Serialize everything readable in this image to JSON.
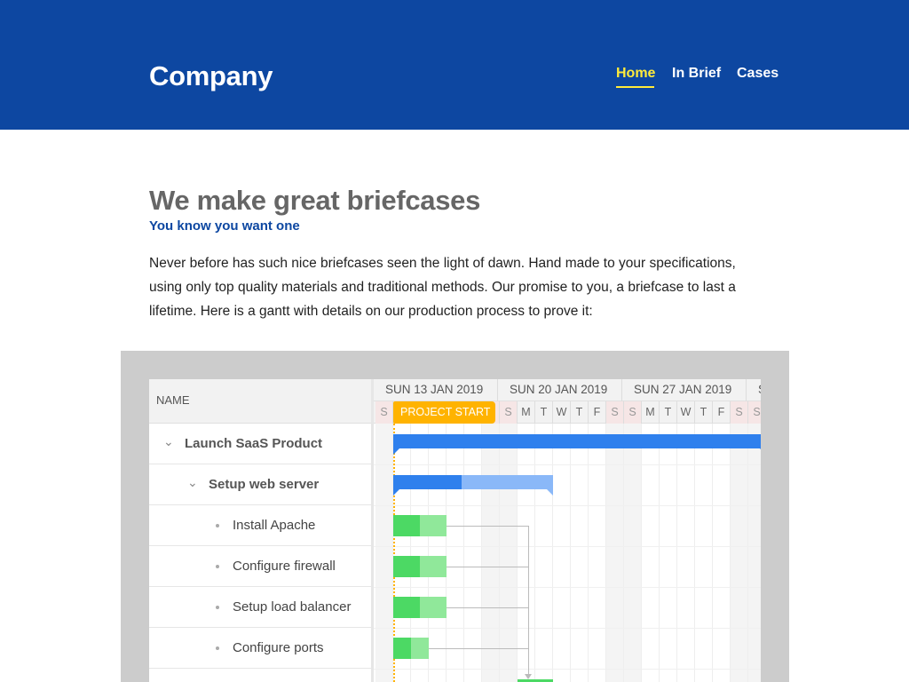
{
  "header": {
    "brand": "Company",
    "nav": [
      {
        "label": "Home",
        "active": true
      },
      {
        "label": "In Brief",
        "active": false
      },
      {
        "label": "Cases",
        "active": false
      }
    ]
  },
  "content": {
    "headline": "We make great briefcases",
    "subheadline": "You know you want one",
    "intro": "Never before has such nice briefcases seen the light of dawn. Hand made to your specifications, using only top quality materials and traditional methods. Our promise to you, a briefcase to last a lifetime. Here is a gantt with details on our production process to prove it:"
  },
  "gantt": {
    "name_header": "NAME",
    "weeks": [
      "SUN 13 JAN 2019",
      "SUN 20 JAN 2019",
      "SUN 27 JAN 2019",
      "S"
    ],
    "days": [
      "S",
      "M",
      "T",
      "W",
      "T",
      "F",
      "S",
      "S",
      "M",
      "T",
      "W",
      "T",
      "F",
      "S",
      "S",
      "M",
      "T",
      "W",
      "T",
      "F",
      "S",
      "S"
    ],
    "project_start_label": "PROJECT START",
    "tasks": [
      {
        "name": "Launch SaaS Product",
        "level": 0,
        "parent": true,
        "percent_done": 100
      },
      {
        "name": "Setup web server",
        "level": 1,
        "parent": true,
        "percent_done": 43
      },
      {
        "name": "Install Apache",
        "level": 2,
        "parent": false,
        "percent_done": 50
      },
      {
        "name": "Configure firewall",
        "level": 2,
        "parent": false,
        "percent_done": 50
      },
      {
        "name": "Setup load balancer",
        "level": 2,
        "parent": false,
        "percent_done": 50
      },
      {
        "name": "Configure ports",
        "level": 2,
        "parent": false,
        "percent_done": 50
      }
    ],
    "colors": {
      "parent_bar": "#2f80ed",
      "parent_bar_light": "#8ab8f8",
      "task_bar": "#4cd964",
      "task_bar_light": "#90e89a",
      "project_start": "#ffb300",
      "brand_blue": "#0d47a1",
      "active_nav": "#ffeb3b"
    }
  }
}
